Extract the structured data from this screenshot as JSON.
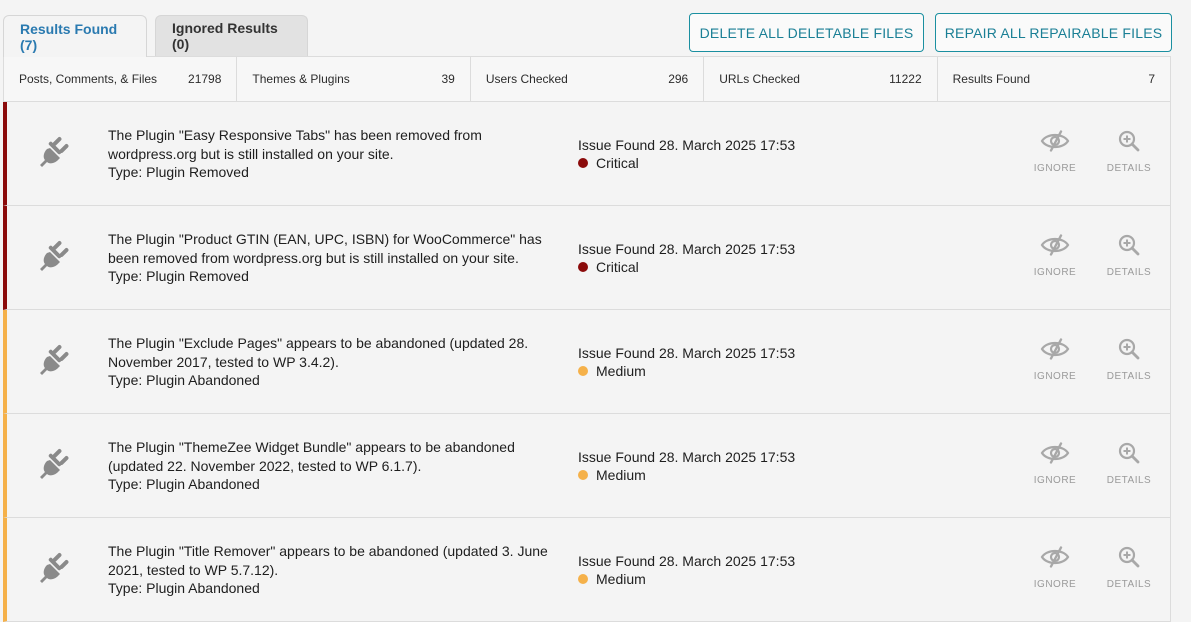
{
  "tabs": [
    {
      "label": "Results Found (7)",
      "active": true
    },
    {
      "label": "Ignored Results (0)",
      "active": false
    }
  ],
  "actions": {
    "delete_all": "DELETE ALL DELETABLE FILES",
    "repair_all": "REPAIR ALL REPAIRABLE FILES"
  },
  "stats": [
    {
      "label": "Posts, Comments, & Files",
      "value": "21798"
    },
    {
      "label": "Themes & Plugins",
      "value": "39"
    },
    {
      "label": "Users Checked",
      "value": "296"
    },
    {
      "label": "URLs Checked",
      "value": "11222"
    },
    {
      "label": "Results Found",
      "value": "7"
    }
  ],
  "colors": {
    "critical": "#8b0b0b",
    "medium": "#f5b14a",
    "accent": "#1a8fa0",
    "tab_active": "#2a7ab0"
  },
  "icons": {
    "row": "plug-icon",
    "ignore": "eye-slash-icon",
    "details": "zoom-in-icon"
  },
  "row_actions": {
    "ignore": "IGNORE",
    "details": "DETAILS"
  },
  "results": [
    {
      "line1": "The Plugin \"Easy Responsive Tabs\" has been removed from wordpress.org but is still installed on your site.",
      "type": "Type: Plugin Removed",
      "found": "Issue Found 28. March 2025 17:53",
      "severity": "Critical"
    },
    {
      "line1": "The Plugin \"Product GTIN (EAN, UPC, ISBN) for WooCommerce\" has been removed from wordpress.org but is still installed on your site.",
      "type": "Type: Plugin Removed",
      "found": "Issue Found 28. March 2025 17:53",
      "severity": "Critical"
    },
    {
      "line1": "The Plugin \"Exclude Pages\" appears to be abandoned (updated 28. November 2017, tested to WP 3.4.2).",
      "type": "Type: Plugin Abandoned",
      "found": "Issue Found 28. March 2025 17:53",
      "severity": "Medium"
    },
    {
      "line1": "The Plugin \"ThemeZee Widget Bundle\" appears to be abandoned (updated 22. November 2022, tested to WP 6.1.7).",
      "type": "Type: Plugin Abandoned",
      "found": "Issue Found 28. March 2025 17:53",
      "severity": "Medium"
    },
    {
      "line1": "The Plugin \"Title Remover\" appears to be abandoned (updated 3. June 2021, tested to WP 5.7.12).",
      "type": "Type: Plugin Abandoned",
      "found": "Issue Found 28. March 2025 17:53",
      "severity": "Medium"
    }
  ]
}
